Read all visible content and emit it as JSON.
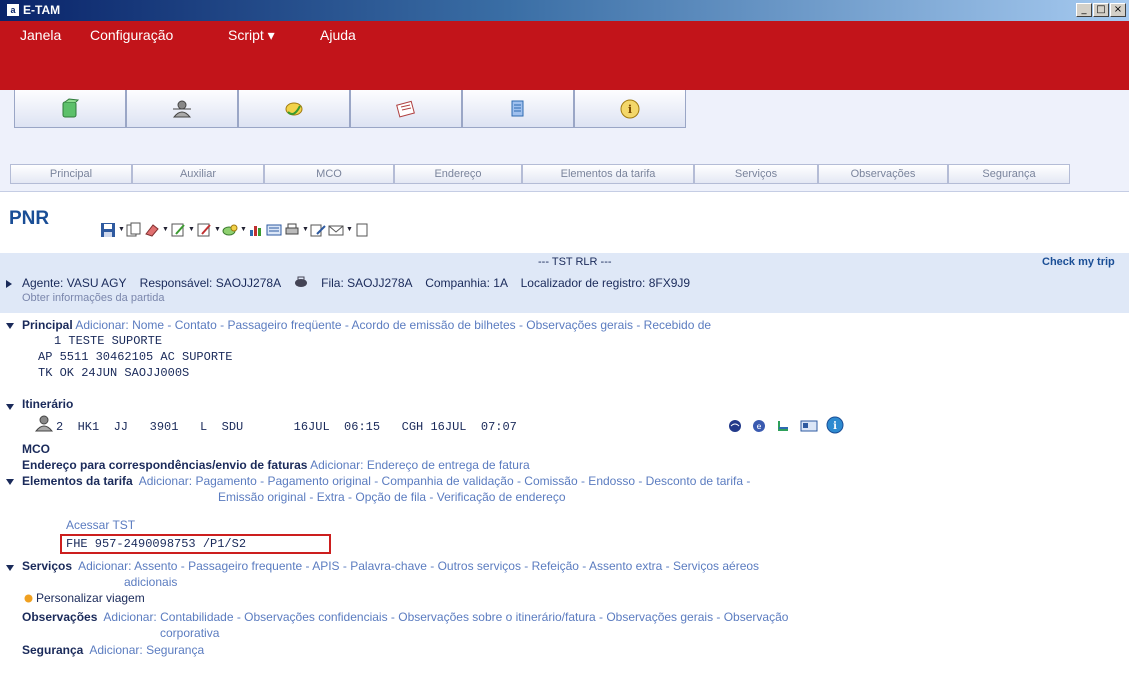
{
  "window": {
    "title": "E-TAM",
    "app_icon": "a",
    "minimize": "_",
    "maximize": "□",
    "close": "×"
  },
  "menu": {
    "items": [
      "Janela",
      "Configuração",
      "Script ▾",
      "Ajuda"
    ]
  },
  "icon_tabs": [
    {
      "icon": "book-icon",
      "color": "#2e9a3e"
    },
    {
      "icon": "agent-icon",
      "color": "#555555"
    },
    {
      "icon": "money-icon",
      "color": "#3a9a2e"
    },
    {
      "icon": "ticket-icon",
      "color": "#b04040"
    },
    {
      "icon": "document-icon",
      "color": "#2e6ab0"
    },
    {
      "icon": "info-icon",
      "color": "#d4a010"
    }
  ],
  "sub_tabs": [
    "Principal",
    "Auxiliar",
    "MCO",
    "Endereço",
    "Elementos da tarifa",
    "Serviços",
    "Observações",
    "Segurança"
  ],
  "pnr": {
    "title": "PNR",
    "tst_title": "--- TST RLR ---",
    "check_trip": "Check my trip",
    "agent_label": "Agente:",
    "agent": "VASU AGY",
    "responsible_label": "Responsável:",
    "responsible": "SAOJJ278A",
    "queue_label": "Fila:",
    "queue": "SAOJJ278A",
    "company_label": "Companhia:",
    "company": "1A",
    "locator_label": "Localizador de registro:",
    "locator": "8FX9J9",
    "get_info": "Obter informações da partida"
  },
  "principal": {
    "label": "Principal",
    "add_label": "Adicionar:",
    "links": "Nome - Contato - Passageiro freqüente - Acordo de emissão de bilhetes - Observações gerais - Recebido de",
    "lines": [
      "1 TESTE SUPORTE",
      "AP 5511 30462105 AC SUPORTE",
      "TK OK 24JUN SAOJJ000S"
    ]
  },
  "itinerary": {
    "label": "Itinerário",
    "segment": "2  HK1  JJ   3901   L  SDU       16JUL  06:15   CGH 16JUL  07:07"
  },
  "mco": {
    "label": "MCO"
  },
  "address": {
    "label": "Endereço para correspondências/envio de faturas",
    "add_label": "Adicionar:",
    "links": "Endereço de entrega de fatura"
  },
  "fare": {
    "label": "Elementos da tarifa",
    "add_label": "Adicionar:",
    "links_1": "Pagamento - Pagamento original - Companhia de validação - Comissão - Endosso - Desconto de tarifa -",
    "links_2": "Emissão original - Extra - Opção de fila - Verificação de endereço",
    "access_tst": "Acessar TST",
    "fhe": "FHE 957-2490098753 /P1/S2"
  },
  "services": {
    "label": "Serviços",
    "add_label": "Adicionar:",
    "links_1": "Assento - Passageiro frequente - APIS - Palavra-chave - Outros serviços - Refeição - Assento extra - Serviços aéreos",
    "links_2": "adicionais",
    "personalize": "Personalizar viagem"
  },
  "observations": {
    "label": "Observações",
    "add_label": "Adicionar:",
    "links_1": "Contabilidade - Observações confidenciais - Observações sobre o itinerário/fatura - Observações gerais - Observação",
    "links_2": "corporativa"
  },
  "security": {
    "label": "Segurança",
    "add_label": "Adicionar:",
    "links": "Segurança"
  }
}
